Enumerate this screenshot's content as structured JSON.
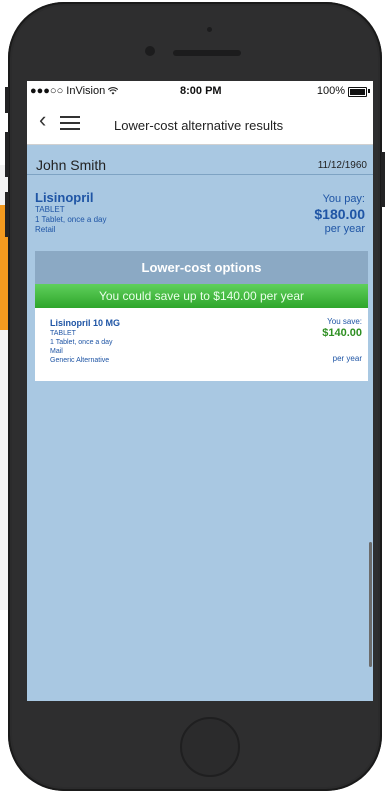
{
  "status_bar": {
    "carrier": "●●●○○ InVision",
    "time": "8:00 PM",
    "battery": "100%"
  },
  "nav": {
    "back_glyph": "‹",
    "title": "Lower-cost alternative results"
  },
  "patient": {
    "name": "John Smith",
    "dob": "11/12/1960"
  },
  "current_drug": {
    "name": "Lisinopril",
    "form": "TABLET",
    "dosage": "1 Tablet, once a day",
    "pharmacy": "Retail",
    "pay_label": "You pay:",
    "pay_amount": "$180.00",
    "pay_period": "per year"
  },
  "options": {
    "header": "Lower-cost options",
    "savings_banner": "You could save up to $140.00 per year",
    "items": [
      {
        "name": "Lisinopril 10 MG",
        "form": "TABLET",
        "dosage": "1 Tablet, once a day",
        "delivery": "Mail",
        "type": "Generic Alternative",
        "save_label": "You save:",
        "save_amount": "$140.00",
        "period": "per year"
      }
    ]
  },
  "colors": {
    "screen_background": "#a9c8e2",
    "accent_blue": "#1f55a5",
    "savings_green": "#2e8f22",
    "banner_green": "#3cb939",
    "options_header": "#8ba9c4"
  },
  "icons": {
    "menu": "hamburger-menu-icon",
    "back": "back-chevron-icon",
    "wifi": "wifi-icon",
    "battery": "battery-icon"
  }
}
